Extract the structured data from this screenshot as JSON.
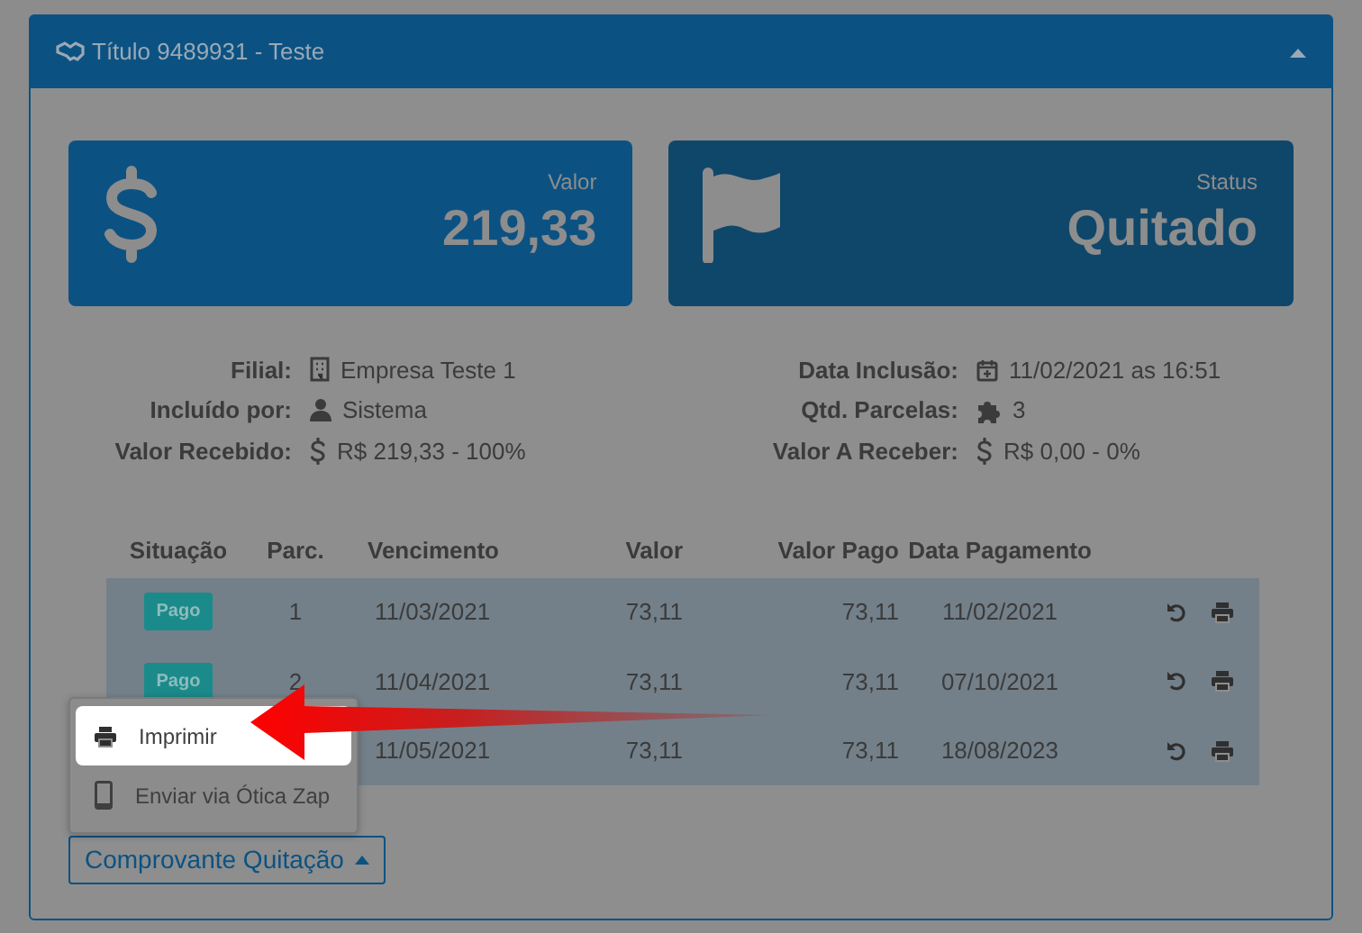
{
  "panel": {
    "title": "Título 9489931 - Teste",
    "expanded": true
  },
  "summary_cards": [
    {
      "kind": "money",
      "label": "Valor",
      "value": "219,33"
    },
    {
      "kind": "flag",
      "label": "Status",
      "value": "Quitado"
    }
  ],
  "details_left": [
    {
      "kind": "building",
      "label": "Filial:",
      "value": "Empresa Teste 1"
    },
    {
      "kind": "user",
      "label": "Incluído por:",
      "value": "Sistema"
    },
    {
      "kind": "dollar",
      "label": "Valor Recebido:",
      "value": "R$ 219,33 - 100%"
    }
  ],
  "details_right": [
    {
      "kind": "calendar",
      "label": "Data Inclusão:",
      "value": "11/02/2021 as 16:51"
    },
    {
      "kind": "puzzle",
      "label": "Qtd. Parcelas:",
      "value": "3"
    },
    {
      "kind": "dollar",
      "label": "Valor A Receber:",
      "value": "R$ 0,00 - 0%"
    }
  ],
  "table": {
    "columns": [
      "Situação",
      "Parc.",
      "Vencimento",
      "Valor",
      "Valor Pago",
      "Data Pagamento"
    ],
    "rows": [
      {
        "status": "Pago",
        "parcel": "1",
        "due": "11/03/2021",
        "value": "73,11",
        "paid": "73,11",
        "paid_date": "11/02/2021"
      },
      {
        "status": "Pago",
        "parcel": "2",
        "due": "11/04/2021",
        "value": "73,11",
        "paid": "73,11",
        "paid_date": "07/10/2021"
      },
      {
        "due": "11/05/2021",
        "value": "73,11",
        "paid": "73,11",
        "paid_date": "18/08/2023"
      }
    ]
  },
  "dropdown": {
    "label": "Comprovante Quitação",
    "expanded": true,
    "items": [
      {
        "kind": "print",
        "label": "Imprimir",
        "selected": true
      },
      {
        "kind": "phone",
        "label": "Enviar via Ótica Zap",
        "selected": false
      }
    ]
  }
}
